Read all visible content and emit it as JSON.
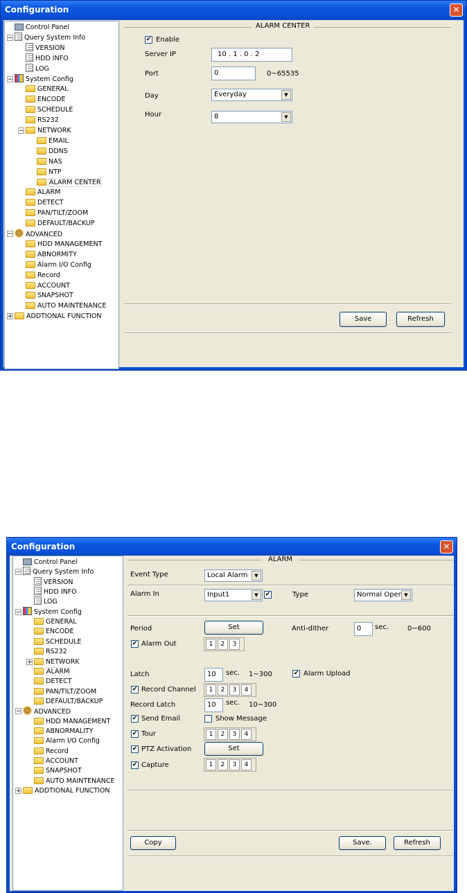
{
  "window1": {
    "title": "Configuration",
    "close": "✕",
    "tree": [
      {
        "label": "Control Panel",
        "icon": "pc"
      },
      {
        "label": "Query System Info",
        "icon": "note"
      },
      {
        "label": "VERSION",
        "icon": "note"
      },
      {
        "label": "HDD INFO",
        "icon": "note"
      },
      {
        "label": "LOG",
        "icon": "note"
      },
      {
        "label": "System Config",
        "icon": "tools"
      },
      {
        "label": "GENERAL",
        "icon": "folder"
      },
      {
        "label": "ENCODE",
        "icon": "folder"
      },
      {
        "label": "SCHEDULE",
        "icon": "folder"
      },
      {
        "label": "RS232",
        "icon": "folder"
      },
      {
        "label": "NETWORK",
        "icon": "folder"
      },
      {
        "label": "EMAIL",
        "icon": "folder"
      },
      {
        "label": "DDNS",
        "icon": "folder"
      },
      {
        "label": "NAS",
        "icon": "folder"
      },
      {
        "label": "NTP",
        "icon": "folder"
      },
      {
        "label": "ALARM CENTER",
        "icon": "folder"
      },
      {
        "label": "ALARM",
        "icon": "folder"
      },
      {
        "label": "DETECT",
        "icon": "folder"
      },
      {
        "label": "PAN/TILT/ZOOM",
        "icon": "folder"
      },
      {
        "label": "DEFAULT/BACKUP",
        "icon": "folder"
      },
      {
        "label": "ADVANCED",
        "icon": "gears"
      },
      {
        "label": "HDD MANAGEMENT",
        "icon": "folder"
      },
      {
        "label": "ABNORMITY",
        "icon": "folder"
      },
      {
        "label": "Alarm I/O Config",
        "icon": "folder"
      },
      {
        "label": "Record",
        "icon": "folder"
      },
      {
        "label": "ACCOUNT",
        "icon": "folder"
      },
      {
        "label": "SNAPSHOT",
        "icon": "folder"
      },
      {
        "label": "AUTO MAINTENANCE",
        "icon": "folder"
      },
      {
        "label": "ADDTIONAL FUNCTION",
        "icon": "folder"
      }
    ],
    "panel": {
      "group_title": "ALARM CENTER",
      "enable_label": "Enable",
      "enable_checked": true,
      "server_ip_label": "Server IP",
      "server_ip": "10 .  1  .  0  .  2",
      "port_label": "Port",
      "port_value": "0",
      "port_range": "0~65535",
      "day_label": "Day",
      "day_value": "Everyday",
      "hour_label": "Hour",
      "hour_value": "8",
      "save": "Save",
      "refresh": "Refresh"
    }
  },
  "window2": {
    "title": "Configuration",
    "close": "✕",
    "tree": [
      {
        "label": "Control Panel",
        "icon": "pc"
      },
      {
        "label": "Query System Info",
        "icon": "note"
      },
      {
        "label": "VERSION",
        "icon": "note"
      },
      {
        "label": "HDD INFO",
        "icon": "note"
      },
      {
        "label": "LOG",
        "icon": "note"
      },
      {
        "label": "System Config",
        "icon": "tools"
      },
      {
        "label": "GENERAL",
        "icon": "folder"
      },
      {
        "label": "ENCODE",
        "icon": "folder"
      },
      {
        "label": "SCHEDULE",
        "icon": "folder"
      },
      {
        "label": "RS232",
        "icon": "folder"
      },
      {
        "label": "NETWORK",
        "icon": "folder"
      },
      {
        "label": "ALARM",
        "icon": "folder"
      },
      {
        "label": "DETECT",
        "icon": "folder"
      },
      {
        "label": "PAN/TILT/ZOOM",
        "icon": "folder"
      },
      {
        "label": "DEFAULT/BACKUP",
        "icon": "folder"
      },
      {
        "label": "ADVANCED",
        "icon": "gears"
      },
      {
        "label": "HDD MANAGEMENT",
        "icon": "folder"
      },
      {
        "label": "ABNORMALITY",
        "icon": "folder"
      },
      {
        "label": "Alarm I/O Config",
        "icon": "folder"
      },
      {
        "label": "Record",
        "icon": "folder"
      },
      {
        "label": "ACCOUNT",
        "icon": "folder"
      },
      {
        "label": "SNAPSHOT",
        "icon": "folder"
      },
      {
        "label": "AUTO MAINTENANCE",
        "icon": "folder"
      },
      {
        "label": "ADDTIONAL FUNCTION",
        "icon": "folder"
      }
    ],
    "panel": {
      "group_title": "ALARM",
      "event_type_label": "Event Type",
      "event_type_value": "Local Alarm",
      "alarm_in_label": "Alarm In",
      "alarm_in_value": "Input1",
      "alarm_in_checked": true,
      "type_label": "Type",
      "type_value": "Normal Open",
      "period_label": "Period",
      "set": "Set",
      "antidither_label": "Anti-dither",
      "antidither_value": "0",
      "sec": "sec.",
      "antidither_range": "0~600",
      "alarm_out_label": "Alarm Out",
      "alarm_out_checked": true,
      "ch3": [
        "1",
        "2",
        "3"
      ],
      "ch4": [
        "1",
        "2",
        "3",
        "4"
      ],
      "latch_label": "Latch",
      "latch_value": "10",
      "latch_range": "1~300",
      "alarm_upload_label": "Alarm Upload",
      "alarm_upload_checked": true,
      "record_channel_label": "Record Channel",
      "record_channel_checked": true,
      "record_latch_label": "Record Latch",
      "record_latch_value": "10",
      "record_latch_range": "10~300",
      "send_email_label": "Send Email",
      "send_email_checked": true,
      "show_message_label": "Show Message",
      "show_message_checked": false,
      "tour_label": "Tour",
      "tour_checked": true,
      "ptz_label": "PTZ Activation",
      "ptz_checked": true,
      "capture_label": "Capture",
      "capture_checked": true,
      "copy": "Copy",
      "save": "Save.",
      "refresh": "Refresh"
    }
  },
  "icons": {
    "check": "✔",
    "arrow": "▼",
    "plus": "+",
    "minus": "−"
  }
}
